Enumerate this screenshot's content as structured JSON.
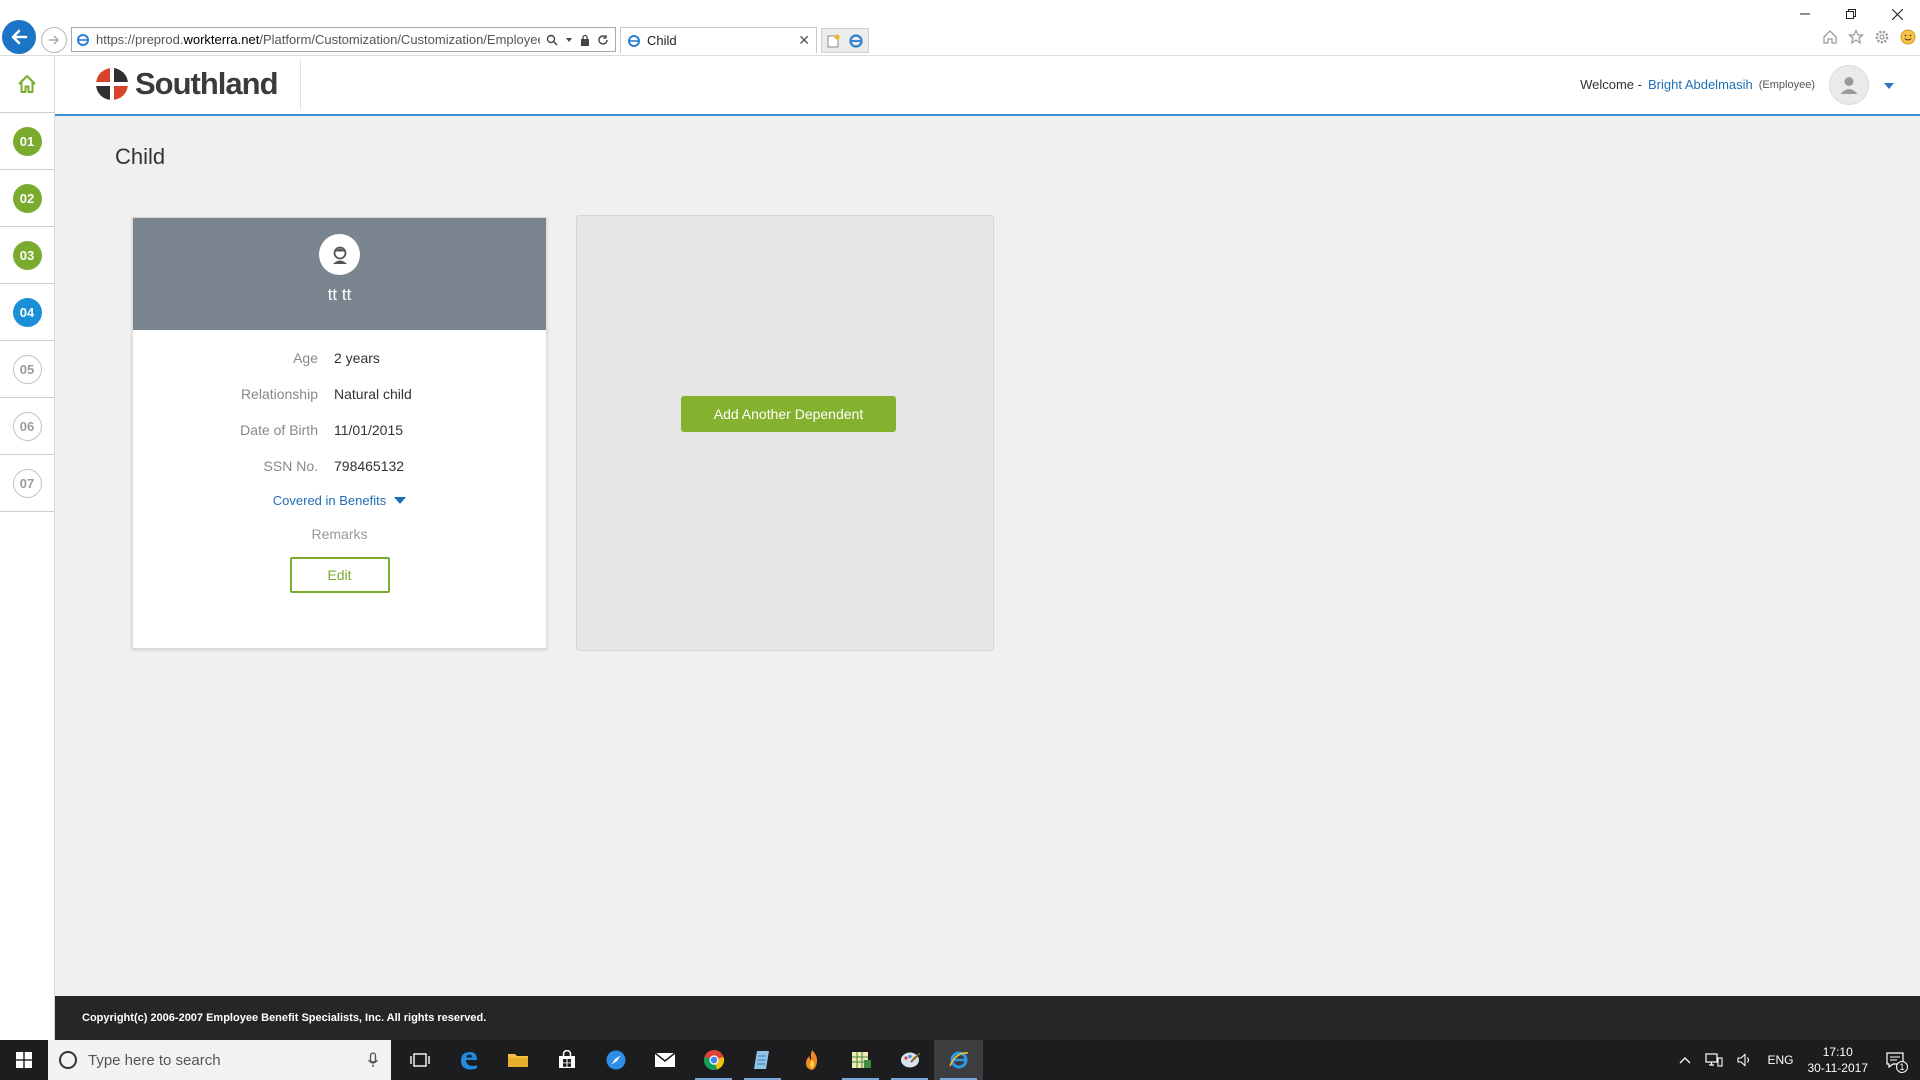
{
  "browser": {
    "url_prefix": "https://preprod.",
    "url_host": "workterra.net",
    "url_path": "/Platform/Customization/Customization/EmployeeProf",
    "tab_title": "Child"
  },
  "header": {
    "logo_text": "Southland",
    "welcome_label": "Welcome -",
    "user_name": "Bright Abdelmasih",
    "user_role": "(Employee)"
  },
  "steps": [
    {
      "label": "01",
      "state": "done"
    },
    {
      "label": "02",
      "state": "done"
    },
    {
      "label": "03",
      "state": "done"
    },
    {
      "label": "04",
      "state": "active"
    },
    {
      "label": "05",
      "state": "todo"
    },
    {
      "label": "06",
      "state": "todo"
    },
    {
      "label": "07",
      "state": "todo"
    }
  ],
  "page": {
    "title": "Child"
  },
  "dependent": {
    "name": "tt tt",
    "fields": [
      {
        "label": "Age",
        "value": "2 years"
      },
      {
        "label": "Relationship",
        "value": "Natural child"
      },
      {
        "label": "Date of Birth",
        "value": "11/01/2015"
      },
      {
        "label": "SSN No.",
        "value": "798465132"
      }
    ],
    "covered_label": "Covered in Benefits",
    "remarks_label": "Remarks",
    "edit_label": "Edit"
  },
  "add_dependent_label": "Add Another Dependent",
  "footer": {
    "copyright": "Copyright(c) 2006-2007 Employee Benefit Specialists, Inc. All rights reserved."
  },
  "taskbar": {
    "search_placeholder": "Type here to search",
    "language": "ENG",
    "time": "17:10",
    "date": "30-11-2017",
    "notification_count": "1"
  },
  "colors": {
    "accent_green": "#7aab2f",
    "accent_blue": "#1a8fd8",
    "card_header": "#7a8590",
    "logo_red": "#d9432c"
  }
}
